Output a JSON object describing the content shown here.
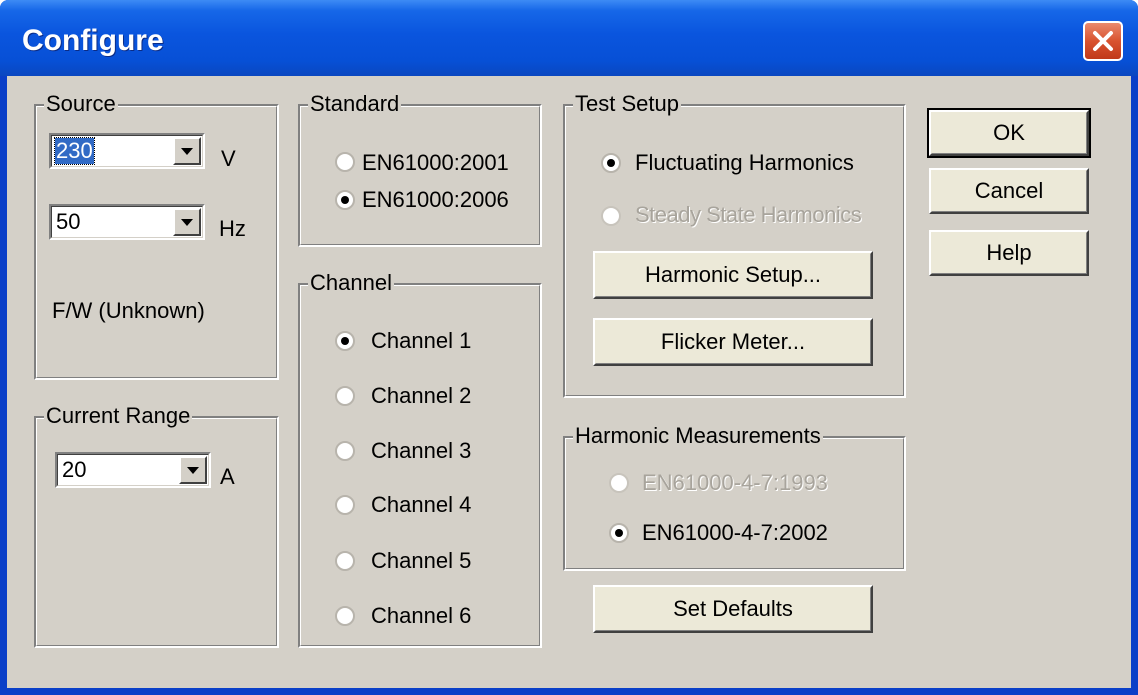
{
  "window": {
    "title": "Configure",
    "close_icon": "close-icon"
  },
  "source": {
    "label": "Source",
    "voltage": {
      "value": "230",
      "unit": "V"
    },
    "frequency": {
      "value": "50",
      "unit": "Hz"
    },
    "firmware": "F/W (Unknown)"
  },
  "current_range": {
    "label": "Current Range",
    "value": "20",
    "unit": "A"
  },
  "standard": {
    "label": "Standard",
    "options": [
      {
        "label": "EN61000:2001",
        "selected": false
      },
      {
        "label": "EN61000:2006",
        "selected": true
      }
    ]
  },
  "channel": {
    "label": "Channel",
    "options": [
      {
        "label": "Channel 1",
        "selected": true
      },
      {
        "label": "Channel 2",
        "selected": false
      },
      {
        "label": "Channel 3",
        "selected": false
      },
      {
        "label": "Channel 4",
        "selected": false
      },
      {
        "label": "Channel 5",
        "selected": false
      },
      {
        "label": "Channel 6",
        "selected": false
      }
    ]
  },
  "test_setup": {
    "label": "Test Setup",
    "options": [
      {
        "label": "Fluctuating Harmonics",
        "selected": true,
        "enabled": true
      },
      {
        "label": "Steady State Harmonics",
        "selected": false,
        "enabled": false
      }
    ],
    "harmonic_setup_button": "Harmonic Setup...",
    "flicker_meter_button": "Flicker Meter..."
  },
  "harmonic_measurements": {
    "label": "Harmonic Measurements",
    "options": [
      {
        "label": "EN61000-4-7:1993",
        "selected": false,
        "enabled": false
      },
      {
        "label": "EN61000-4-7:2002",
        "selected": true,
        "enabled": true
      }
    ]
  },
  "buttons": {
    "ok": "OK",
    "cancel": "Cancel",
    "help": "Help",
    "set_defaults": "Set Defaults"
  }
}
